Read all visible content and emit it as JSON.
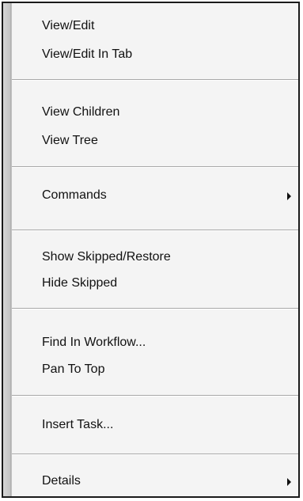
{
  "context_menu": {
    "groups": [
      {
        "items": [
          {
            "label": "View/Edit"
          },
          {
            "label": "View/Edit In Tab"
          }
        ]
      },
      {
        "items": [
          {
            "label": "View Children"
          },
          {
            "label": "View Tree"
          }
        ]
      },
      {
        "items": [
          {
            "label": "Commands",
            "has_submenu": true
          }
        ]
      },
      {
        "items": [
          {
            "label": "Show Skipped/Restore"
          },
          {
            "label": "Hide Skipped"
          }
        ]
      },
      {
        "items": [
          {
            "label": "Find In Workflow..."
          },
          {
            "label": "Pan To Top"
          }
        ]
      },
      {
        "items": [
          {
            "label": "Insert Task..."
          }
        ]
      },
      {
        "items": [
          {
            "label": "Details",
            "has_submenu": true
          }
        ]
      }
    ],
    "submenu_indicator_icon": "chevron-right-icon"
  }
}
